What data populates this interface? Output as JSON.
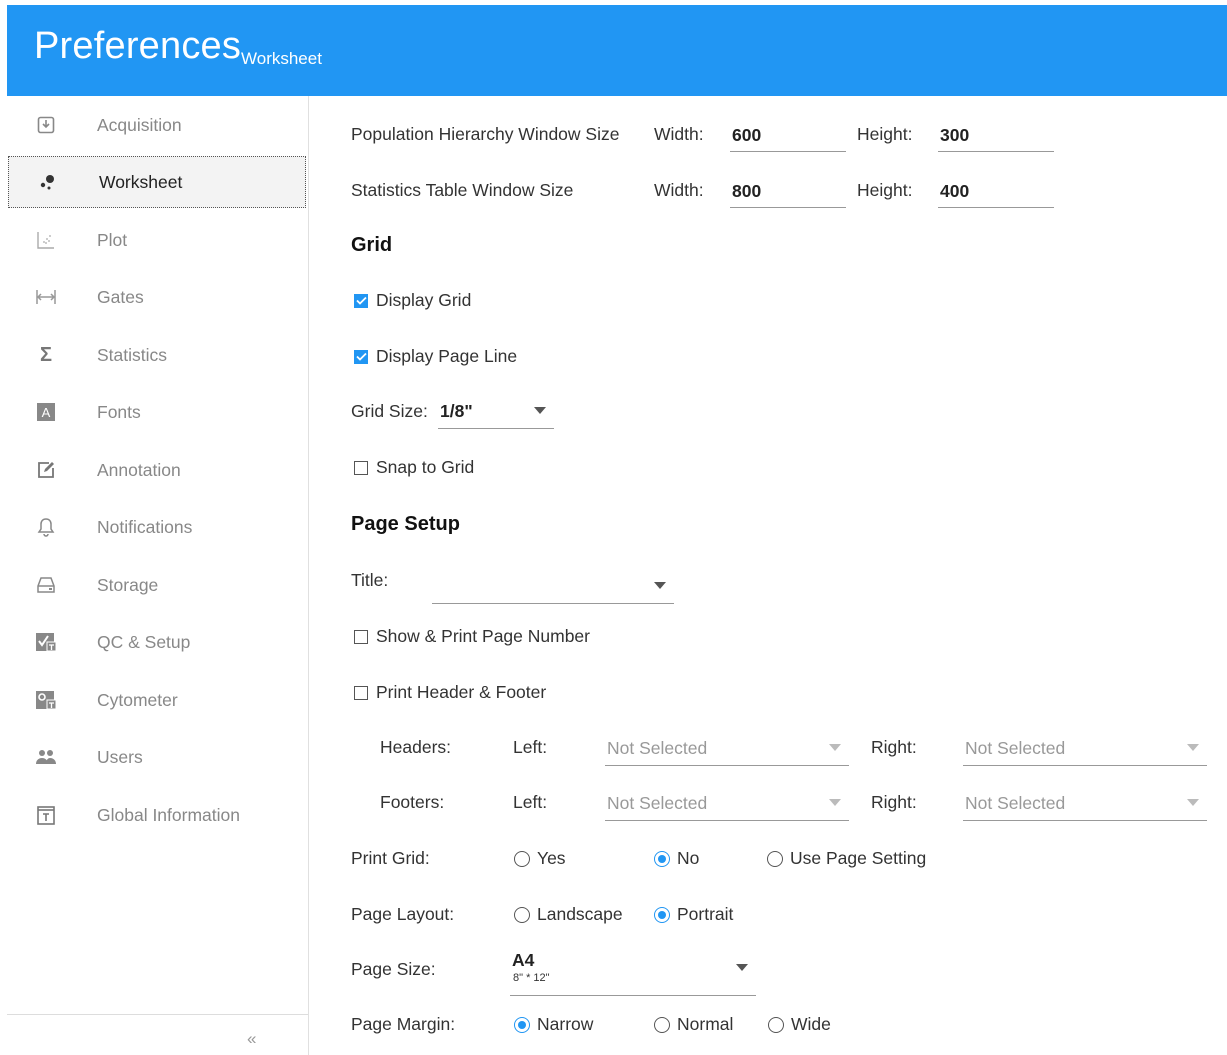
{
  "header": {
    "title": "Preferences",
    "subtitle": "Worksheet"
  },
  "sidebar": {
    "items": [
      {
        "label": "Acquisition",
        "icon": "acquisition-icon"
      },
      {
        "label": "Worksheet",
        "icon": "worksheet-icon",
        "active": true
      },
      {
        "label": "Plot",
        "icon": "plot-icon"
      },
      {
        "label": "Gates",
        "icon": "gates-icon"
      },
      {
        "label": "Statistics",
        "icon": "sigma-icon"
      },
      {
        "label": "Fonts",
        "icon": "font-icon"
      },
      {
        "label": "Annotation",
        "icon": "annotation-icon"
      },
      {
        "label": "Notifications",
        "icon": "bell-icon"
      },
      {
        "label": "Storage",
        "icon": "storage-icon"
      },
      {
        "label": "QC & Setup",
        "icon": "qc-icon"
      },
      {
        "label": "Cytometer",
        "icon": "cytometer-icon"
      },
      {
        "label": "Users",
        "icon": "users-icon"
      },
      {
        "label": "Global Information",
        "icon": "global-info-icon"
      }
    ],
    "collapse": "«"
  },
  "windows": {
    "population": {
      "label": "Population Hierarchy Window Size",
      "width_label": "Width:",
      "width": "600",
      "height_label": "Height:",
      "height": "300"
    },
    "statistics": {
      "label": "Statistics Table Window Size",
      "width_label": "Width:",
      "width": "800",
      "height_label": "Height:",
      "height": "400"
    }
  },
  "grid": {
    "heading": "Grid",
    "display_grid": {
      "label": "Display Grid",
      "checked": true
    },
    "display_page_line": {
      "label": "Display Page Line",
      "checked": true
    },
    "grid_size_label": "Grid Size:",
    "grid_size": "1/8\"",
    "snap": {
      "label": "Snap to Grid",
      "checked": false
    }
  },
  "page_setup": {
    "heading": "Page Setup",
    "title_label": "Title:",
    "title_value": "",
    "show_page_number": {
      "label": "Show & Print Page Number",
      "checked": false
    },
    "print_header_footer": {
      "label": "Print Header & Footer",
      "checked": false
    },
    "headers": {
      "label": "Headers:",
      "left_label": "Left:",
      "left": "Not Selected",
      "right_label": "Right:",
      "right": "Not Selected"
    },
    "footers": {
      "label": "Footers:",
      "left_label": "Left:",
      "left": "Not Selected",
      "right_label": "Right:",
      "right": "Not Selected"
    },
    "print_grid": {
      "label": "Print Grid:",
      "options": [
        "Yes",
        "No",
        "Use Page Setting"
      ],
      "selected": "No"
    },
    "page_layout": {
      "label": "Page Layout:",
      "options": [
        "Landscape",
        "Portrait"
      ],
      "selected": "Portrait"
    },
    "page_size": {
      "label": "Page Size:",
      "value": "A4",
      "sub": "8\" * 12\""
    },
    "page_margin": {
      "label": "Page Margin:",
      "options": [
        "Narrow",
        "Normal",
        "Wide"
      ],
      "selected": "Narrow"
    }
  },
  "colors": {
    "accent": "#2196f3"
  }
}
